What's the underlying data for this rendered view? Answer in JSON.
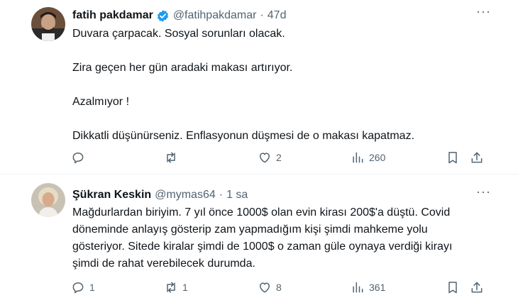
{
  "tweets": [
    {
      "name": "fatih pakdamar",
      "handle": "@fatihpakdamar",
      "separator": "·",
      "time": "47d",
      "more": "···",
      "lines": [
        "Duvara çarpacak. Sosyal sorunları olacak.",
        "Zira geçen her gün aradaki makası artırıyor.",
        "Azalmıyor !",
        "Dikkatli düşünürseniz. Enflasyonun düşmesi de o makası kapatmaz."
      ],
      "replies": "",
      "retweets": "",
      "likes": "2",
      "views": "260"
    },
    {
      "name": "Şükran Keskin",
      "handle": "@mymas64",
      "separator": "·",
      "time": "1 sa",
      "more": "···",
      "lines": [
        "Mağdurlardan biriyim. 7 yıl önce 1000$ olan evin kirası 200$'a düştü. Covid",
        "döneminde anlayış gösterip zam yapmadığım kişi şimdi mahkeme yolu",
        "gösteriyor. Sitede kiralar şimdi de 1000$  o zaman güle oynaya verdiği kirayı",
        "şimdi de rahat verebilecek durumda."
      ],
      "replies": "1",
      "retweets": "1",
      "likes": "8",
      "views": "361"
    }
  ],
  "icons": {
    "verified_color": "#1d9bf0",
    "names": [
      "verified-badge-icon",
      "reply-icon",
      "retweet-icon",
      "like-icon",
      "views-icon",
      "bookmark-icon",
      "share-icon",
      "more-icon"
    ]
  }
}
